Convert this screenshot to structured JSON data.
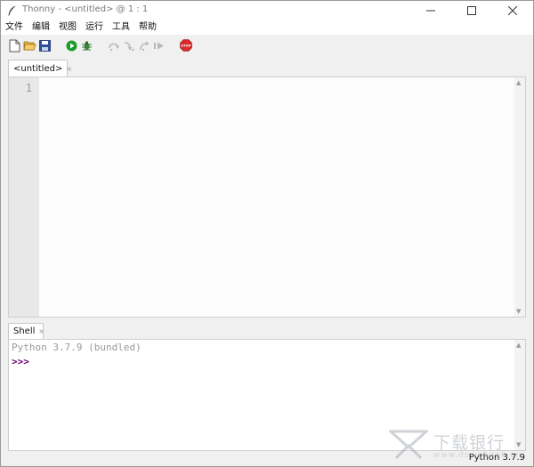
{
  "window": {
    "title": "Thonny  -  <untitled>  @  1 : 1",
    "icons": {
      "app": "feather-icon",
      "minimize": "minimize-icon",
      "maximize": "maximize-icon",
      "close": "close-icon"
    }
  },
  "menu": {
    "items": [
      "文件",
      "编辑",
      "视图",
      "运行",
      "工具",
      "帮助"
    ]
  },
  "toolbar": {
    "buttons": [
      {
        "name": "new-file",
        "icon": "new-file-icon",
        "enabled": true
      },
      {
        "name": "open-file",
        "icon": "folder-open-icon",
        "enabled": true
      },
      {
        "name": "save-file",
        "icon": "floppy-disk-icon",
        "enabled": true
      },
      {
        "name": "run",
        "icon": "run-icon",
        "enabled": true
      },
      {
        "name": "debug",
        "icon": "bug-icon",
        "enabled": true
      },
      {
        "name": "step-over",
        "icon": "step-over-icon",
        "enabled": false
      },
      {
        "name": "step-into",
        "icon": "step-into-icon",
        "enabled": false
      },
      {
        "name": "step-out",
        "icon": "step-out-icon",
        "enabled": false
      },
      {
        "name": "resume",
        "icon": "resume-icon",
        "enabled": false
      },
      {
        "name": "stop",
        "icon": "stop-icon",
        "enabled": true,
        "label": "STOP"
      }
    ]
  },
  "editor": {
    "tab_label": "<untitled>",
    "tab_close": "×",
    "line_numbers": [
      "1"
    ]
  },
  "shell": {
    "tab_label": "Shell",
    "tab_close": "×",
    "banner": "Python 3.7.9 (bundled)",
    "prompt": ">>>"
  },
  "status": {
    "interpreter": "Python 3.7.9"
  },
  "watermark": {
    "text": "下载银行",
    "subtext": "www.downbank.cn"
  },
  "colors": {
    "gutter": "#e8e8e8",
    "prompt": "#6b006b",
    "banner": "#9a9a9a",
    "run_green": "#1c9b2d",
    "stop_red": "#d92b2b"
  }
}
